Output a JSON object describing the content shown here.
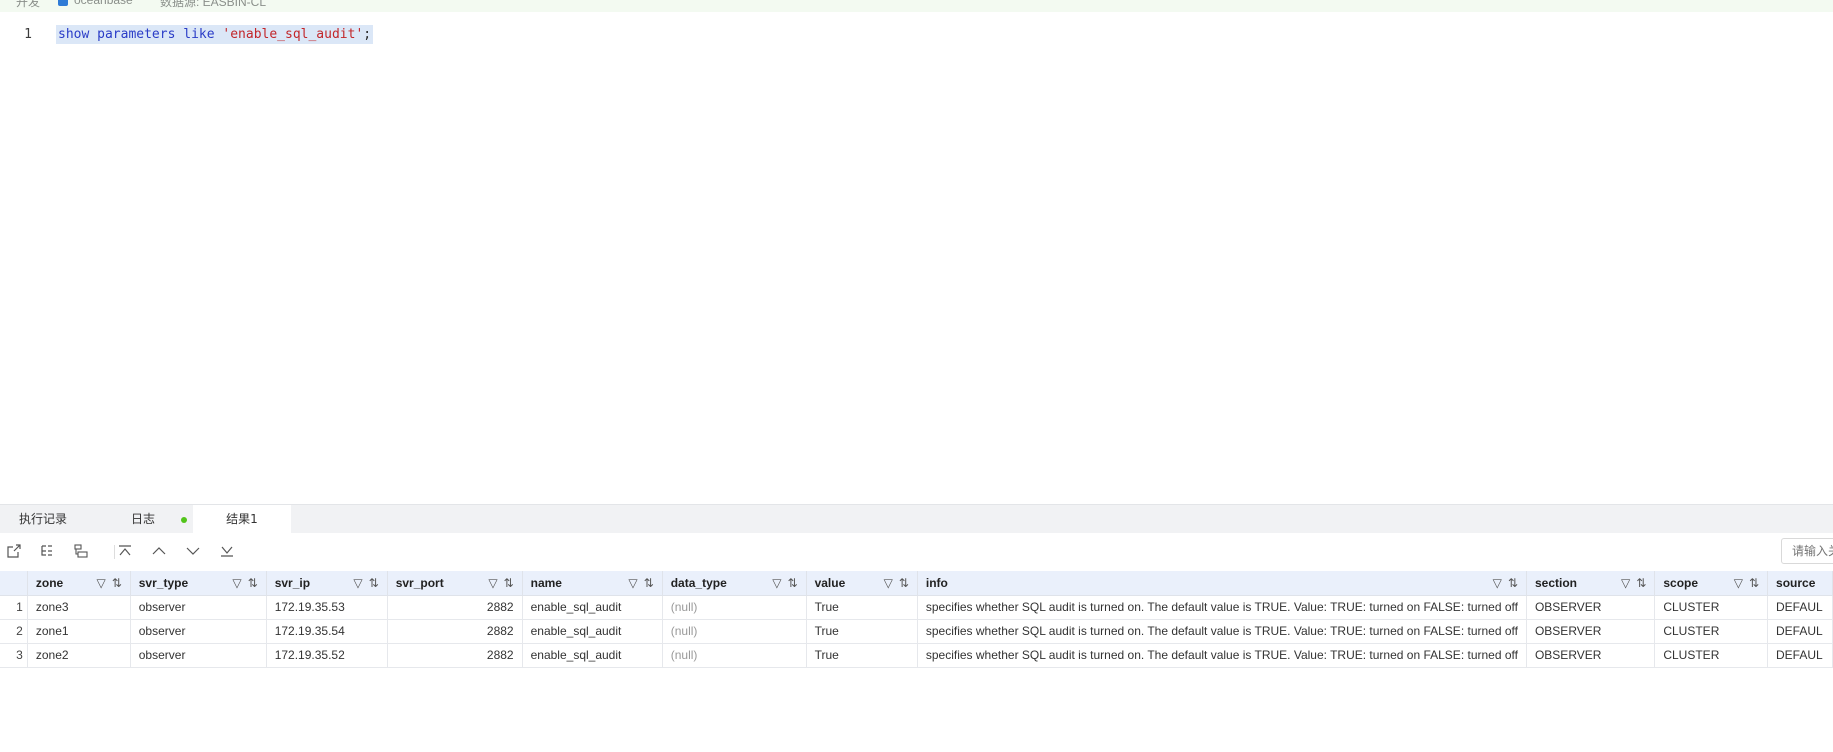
{
  "topbar": {
    "left_text": "开发",
    "datasource": "oceanbase",
    "breadcrumb": "数据源: EASBIN-CL"
  },
  "editor": {
    "line_number": "1",
    "code": {
      "kw1": "show",
      "kw2": "parameters",
      "kw3": "like",
      "str": "'enable_sql_audit'",
      "punc": ";"
    }
  },
  "bottom_tabs": [
    {
      "label": "执行记录"
    },
    {
      "label": "日志"
    },
    {
      "label": "结果1"
    }
  ],
  "toolbar": {
    "search_placeholder": "请输入关键字",
    "icons": [
      "export-icon",
      "tree-icon",
      "layout-icon",
      "top-icon",
      "up-icon",
      "down-icon",
      "bottom-icon"
    ]
  },
  "table": {
    "columns": [
      "zone",
      "svr_type",
      "svr_ip",
      "svr_port",
      "name",
      "data_type",
      "value",
      "info",
      "section",
      "scope",
      "source"
    ],
    "rows": [
      {
        "rn": "1",
        "zone": "zone3",
        "svr_type": "observer",
        "svr_ip": "172.19.35.53",
        "svr_port": "2882",
        "name": "enable_sql_audit",
        "data_type": "(null)",
        "value": "True",
        "info": "specifies whether SQL audit is turned on. The default value is TRUE. Value: TRUE: turned on FALSE: turned off",
        "section": "OBSERVER",
        "scope": "CLUSTER",
        "source": "DEFAUL"
      },
      {
        "rn": "2",
        "zone": "zone1",
        "svr_type": "observer",
        "svr_ip": "172.19.35.54",
        "svr_port": "2882",
        "name": "enable_sql_audit",
        "data_type": "(null)",
        "value": "True",
        "info": "specifies whether SQL audit is turned on. The default value is TRUE. Value: TRUE: turned on FALSE: turned off",
        "section": "OBSERVER",
        "scope": "CLUSTER",
        "source": "DEFAUL"
      },
      {
        "rn": "3",
        "zone": "zone2",
        "svr_type": "observer",
        "svr_ip": "172.19.35.52",
        "svr_port": "2882",
        "name": "enable_sql_audit",
        "data_type": "(null)",
        "value": "True",
        "info": "specifies whether SQL audit is turned on. The default value is TRUE. Value: TRUE: turned on FALSE: turned off",
        "section": "OBSERVER",
        "scope": "CLUSTER",
        "source": "DEFAUL"
      }
    ]
  }
}
